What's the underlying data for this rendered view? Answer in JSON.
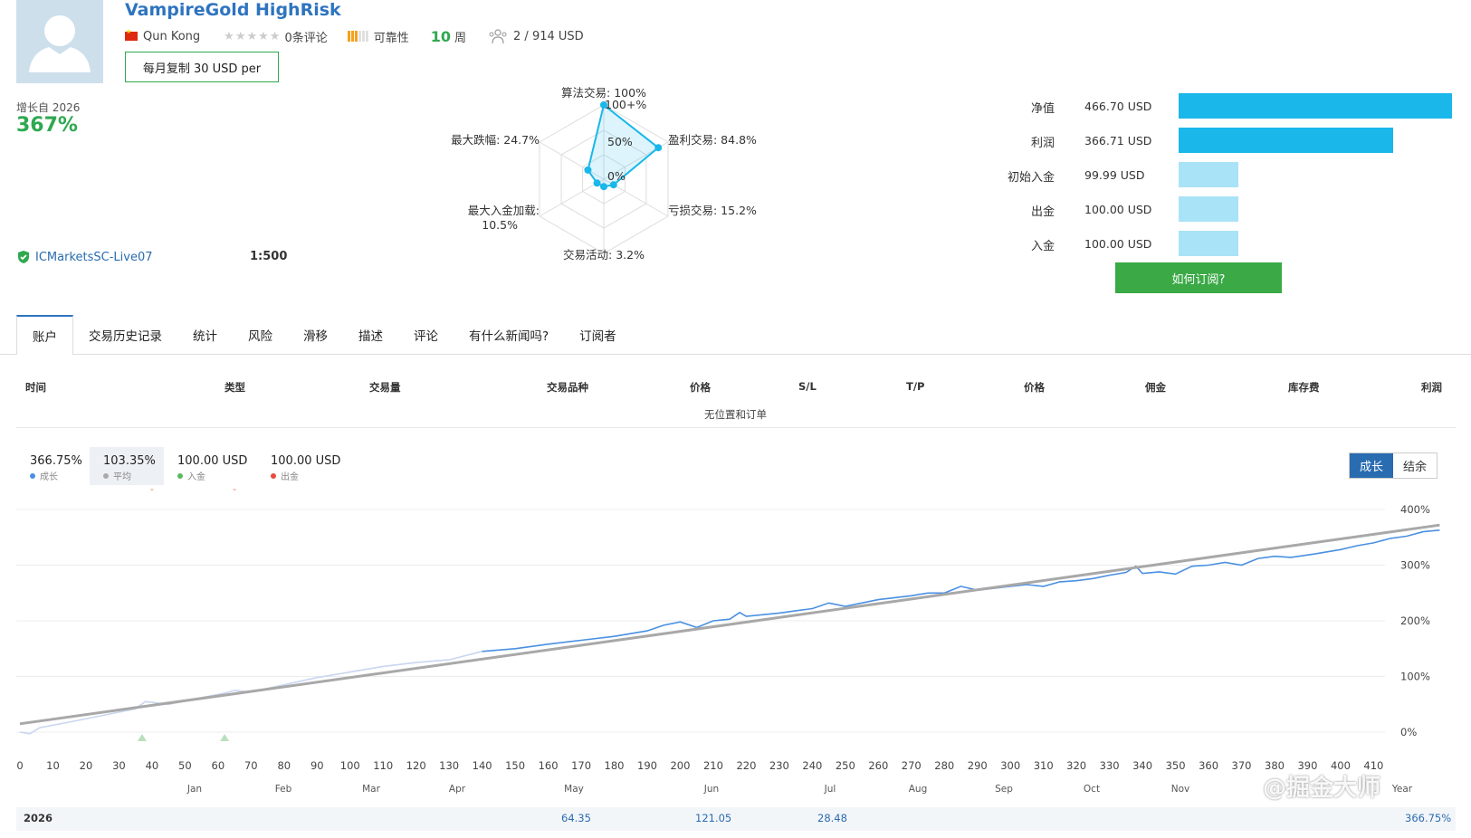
{
  "header": {
    "title": "VampireGold HighRisk",
    "author": "Qun Kong",
    "reviews": "0条评论",
    "reliability": "可靠性",
    "weeks_num": "10",
    "weeks_unit": "周",
    "subscribers": "2 / 914 USD",
    "subscribe_button": "每月复制 30 USD per"
  },
  "growth": {
    "label": "增长自 2026",
    "value": "367%"
  },
  "account": {
    "broker": "ICMarketsSC-Live07",
    "leverage": "1:500"
  },
  "radar": {
    "algo": "算法交易: 100%",
    "profit_trades": "盈利交易: 84.8%",
    "loss_trades": "亏损交易: 15.2%",
    "activity": "交易活动: 3.2%",
    "max_deposit_load_1": "最大入金加载:",
    "max_deposit_load_2": "10.5%",
    "max_drawdown": "最大跌幅: 24.7%",
    "ring_100": "100+%",
    "ring_50": "50%",
    "ring_0": "0%",
    "values": [
      1.0,
      0.848,
      0.152,
      0.032,
      0.105,
      0.247
    ]
  },
  "balance": {
    "rows": [
      {
        "label": "净值",
        "value": "466.70 USD",
        "amount": 466.7
      },
      {
        "label": "利润",
        "value": "366.71 USD",
        "amount": 366.71
      },
      {
        "label": "初始入金",
        "value": "99.99 USD",
        "amount": 99.99
      },
      {
        "label": "出金",
        "value": "100.00 USD",
        "amount": 100.0
      },
      {
        "label": "入金",
        "value": "100.00 USD",
        "amount": 100.0
      }
    ],
    "howto_button": "如何订阅?",
    "colors": {
      "strong": "#1ab7ea",
      "light": "#a9e3f8"
    }
  },
  "tabs": [
    "账户",
    "交易历史记录",
    "统计",
    "风险",
    "滑移",
    "描述",
    "评论",
    "有什么新闻吗?",
    "订阅者"
  ],
  "positions": {
    "headers": [
      "时间",
      "类型",
      "交易量",
      "交易品种",
      "价格",
      "S/L",
      "T/P",
      "价格",
      "佣金",
      "库存费",
      "利润"
    ],
    "empty": "无位置和订单"
  },
  "summary": [
    {
      "value": "366.75%",
      "label": "成长",
      "color": "#4a90e2"
    },
    {
      "value": "103.35%",
      "label": "平均",
      "color": "#aaaaaa"
    },
    {
      "value": "100.00 USD",
      "label": "入金",
      "color": "#5cb85c"
    },
    {
      "value": "100.00 USD",
      "label": "出金",
      "color": "#e74c3c"
    }
  ],
  "toggle": {
    "growth": "成长",
    "balance": "结余"
  },
  "chart_data": {
    "type": "line",
    "x_ticks": [
      0,
      10,
      20,
      30,
      40,
      50,
      60,
      70,
      80,
      90,
      100,
      110,
      120,
      130,
      140,
      150,
      160,
      170,
      180,
      190,
      200,
      210,
      220,
      230,
      240,
      250,
      260,
      270,
      280,
      290,
      300,
      310,
      320,
      330,
      340,
      350,
      360,
      370,
      380,
      390,
      400,
      410
    ],
    "y_ticks": [
      "400%",
      "300%",
      "200%",
      "100%",
      "0%"
    ],
    "months": [
      "Jan",
      "Feb",
      "Mar",
      "Apr",
      "May",
      "Jun",
      "Jul",
      "Aug",
      "Sep",
      "Oct",
      "Nov",
      "Year"
    ],
    "xlim": [
      0,
      414
    ],
    "ylim": [
      -20,
      420
    ],
    "series": [
      {
        "points": [
          [
            0,
            0
          ],
          [
            3,
            -3
          ],
          [
            6,
            8
          ],
          [
            15,
            18
          ],
          [
            25,
            30
          ],
          [
            35,
            42
          ],
          [
            38,
            55
          ],
          [
            45,
            50
          ],
          [
            55,
            62
          ],
          [
            62,
            70
          ],
          [
            65,
            75
          ],
          [
            70,
            72
          ],
          [
            80,
            85
          ],
          [
            90,
            98
          ],
          [
            100,
            108
          ],
          [
            110,
            118
          ],
          [
            120,
            125
          ],
          [
            130,
            130
          ],
          [
            140,
            145
          ],
          [
            150,
            150
          ],
          [
            160,
            158
          ],
          [
            170,
            165
          ],
          [
            180,
            172
          ],
          [
            190,
            182
          ],
          [
            195,
            192
          ],
          [
            200,
            198
          ],
          [
            205,
            188
          ],
          [
            210,
            200
          ],
          [
            215,
            203
          ],
          [
            218,
            215
          ],
          [
            220,
            208
          ],
          [
            230,
            214
          ],
          [
            240,
            222
          ],
          [
            245,
            232
          ],
          [
            250,
            226
          ],
          [
            260,
            238
          ],
          [
            270,
            245
          ],
          [
            275,
            250
          ],
          [
            280,
            250
          ],
          [
            285,
            262
          ],
          [
            290,
            255
          ],
          [
            300,
            262
          ],
          [
            305,
            265
          ],
          [
            310,
            262
          ],
          [
            315,
            270
          ],
          [
            320,
            272
          ],
          [
            325,
            276
          ],
          [
            330,
            282
          ],
          [
            335,
            287
          ],
          [
            338,
            298
          ],
          [
            340,
            285
          ],
          [
            345,
            288
          ],
          [
            350,
            284
          ],
          [
            355,
            298
          ],
          [
            360,
            300
          ],
          [
            365,
            305
          ],
          [
            370,
            300
          ],
          [
            375,
            312
          ],
          [
            380,
            316
          ],
          [
            385,
            314
          ],
          [
            392,
            320
          ],
          [
            400,
            328
          ],
          [
            405,
            335
          ],
          [
            410,
            340
          ],
          [
            415,
            348
          ],
          [
            420,
            352
          ],
          [
            425,
            360
          ],
          [
            430,
            363
          ]
        ]
      },
      {
        "points": [
          [
            0,
            15
          ],
          [
            430,
            372
          ]
        ]
      }
    ],
    "markers_top": [
      40,
      65
    ],
    "markers_bottom": [
      37,
      62
    ]
  },
  "year_row": {
    "year": "2026",
    "values": [
      "64.35",
      "121.05",
      "28.48"
    ],
    "total": "366.75%"
  },
  "watermark": "@掘金大师"
}
